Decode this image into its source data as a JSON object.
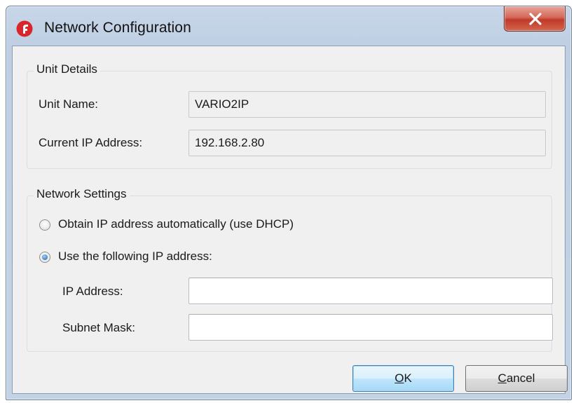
{
  "window": {
    "title": "Network Configuration"
  },
  "unit_details": {
    "legend": "Unit Details",
    "unit_name_label": "Unit Name:",
    "unit_name_value": "VARIO2IP",
    "current_ip_label": "Current IP Address:",
    "current_ip_value": "192.168.2.80"
  },
  "network_settings": {
    "legend": "Network Settings",
    "dhcp_option": {
      "label": "Obtain IP address automatically (use DHCP)",
      "checked": false
    },
    "static_option": {
      "label": "Use the following IP address:",
      "checked": true
    },
    "ip_address_label": "IP Address:",
    "ip_address_value": "",
    "subnet_mask_label": "Subnet Mask:",
    "subnet_mask_value": ""
  },
  "buttons": {
    "ok": {
      "mnemonic": "O",
      "rest": "K"
    },
    "cancel": {
      "mnemonic": "C",
      "rest": "ancel"
    }
  },
  "colors": {
    "app_icon": "#d9262a",
    "close_button": "#c13a28",
    "default_button_border": "#3c7fb1"
  }
}
